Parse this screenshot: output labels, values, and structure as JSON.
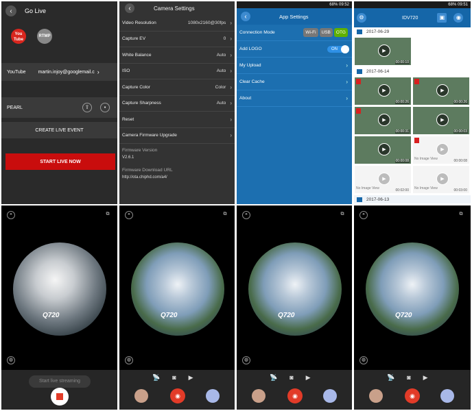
{
  "golive": {
    "title": "Go Live",
    "youtube_badge": "You Tube",
    "rtmp_badge": "RTMP",
    "youtube_label": "YouTube",
    "youtube_account": "martin.injoy@googlemail.c",
    "pearl_label": "PEARL",
    "create_event": "CREATE LIVE EVENT",
    "start_live": "START LIVE NOW"
  },
  "camera_settings": {
    "title": "Camera Settings",
    "rows": [
      {
        "label": "Video Resolution",
        "value": "1080x2160@30fps"
      },
      {
        "label": "Capture EV",
        "value": "0"
      },
      {
        "label": "White Balance",
        "value": "Auto"
      },
      {
        "label": "ISO",
        "value": "Auto"
      },
      {
        "label": "Capture Color",
        "value": "Color"
      },
      {
        "label": "Capture Sharpness",
        "value": "Auto"
      },
      {
        "label": "Reset",
        "value": ""
      },
      {
        "label": "Camera Firmware Upgrade",
        "value": ""
      }
    ],
    "firmware_version_label": "Firmware Version",
    "firmware_version": "V2.6.1",
    "firmware_url_label": "Firmware Download URL",
    "firmware_url": "http://ota.chiphd.com/a4/"
  },
  "app_settings": {
    "status_time": "09:52",
    "status_battery": "68%",
    "title": "App Settings",
    "connection_mode_label": "Connection Mode",
    "modes": [
      "Wi-Fi",
      "USB",
      "OTG"
    ],
    "add_logo_label": "Add LOGO",
    "toggle_label": "ON",
    "my_upload": "My Upload",
    "clear_cache": "Clear Cache",
    "about": "About"
  },
  "gallery": {
    "status_time": "09:51",
    "status_battery": "68%",
    "title": "IDV720",
    "dates": [
      "2017-06-29",
      "2017-06-14",
      "2017-06-13"
    ],
    "durations": [
      "00:00:10",
      "00:00:26",
      "00:00:26",
      "00:00:31",
      "00:00:03",
      "00:00:08",
      "00:00:08",
      "00:02:00",
      "00:03:00"
    ],
    "no_image": "No Image View"
  },
  "viewer": {
    "logo": "Q720",
    "start_streaming": "Start live streaming"
  },
  "colors": {
    "accent_blue": "#1566a8",
    "live_red": "#c90d0d",
    "mode_green": "#5fb000"
  }
}
